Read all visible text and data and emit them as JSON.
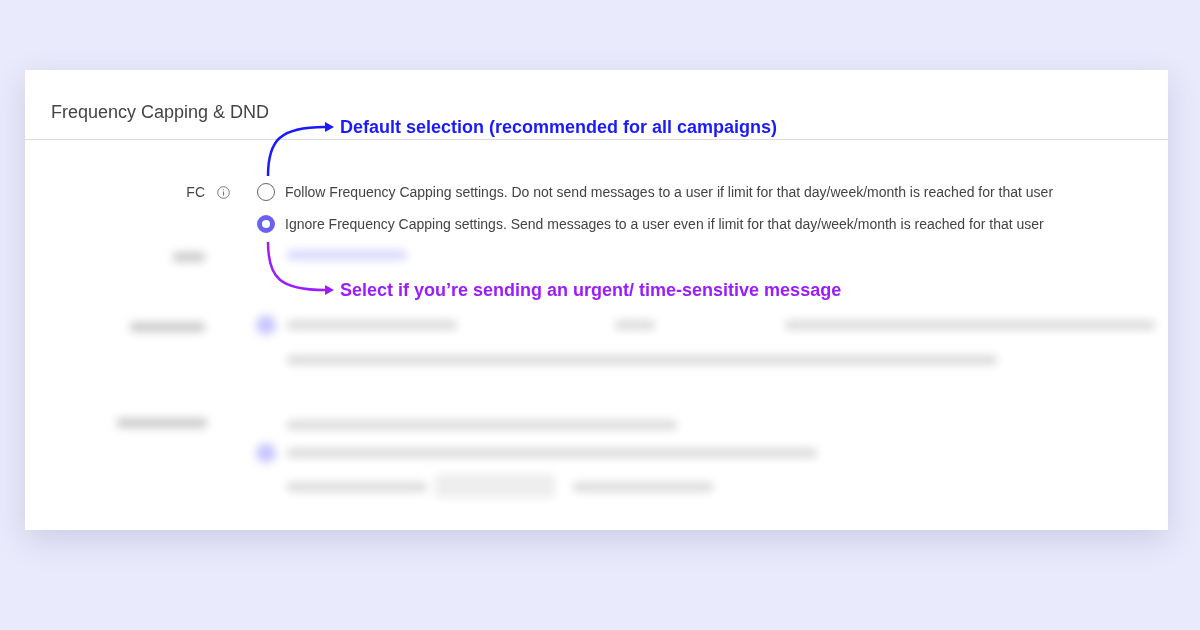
{
  "section": {
    "title": "Frequency Capping & DND"
  },
  "fc": {
    "label": "FC",
    "options": [
      {
        "label": "Follow Frequency Capping settings. Do not send messages to a user if limit for that day/week/month is reached for that user",
        "selected": false
      },
      {
        "label": "Ignore Frequency Capping settings. Send messages to a user even if limit for that day/week/month is reached for that user",
        "selected": true
      }
    ]
  },
  "annotations": [
    {
      "text": "Default selection (recommended for all campaigns)",
      "color": "#1a1aff"
    },
    {
      "text": "Select if you’re sending an urgent/ time-sensitive message",
      "color": "#9b1cff"
    }
  ]
}
